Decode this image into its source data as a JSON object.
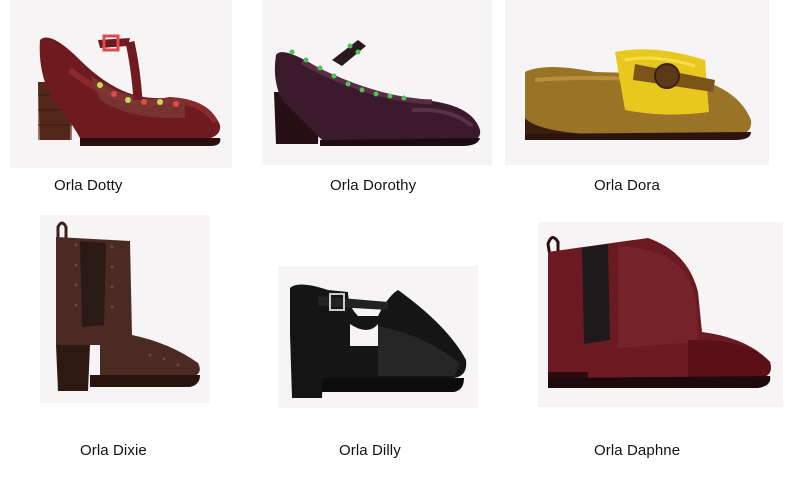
{
  "products": [
    {
      "name": "Orla Dotty",
      "image_icon": "t-bar-shoe-icon",
      "color": "#6e1a1f"
    },
    {
      "name": "Orla Dorothy",
      "image_icon": "mary-jane-shoe-icon",
      "color": "#3a1a2b"
    },
    {
      "name": "Orla Dora",
      "image_icon": "loafer-shoe-icon",
      "color": "#9a7426"
    },
    {
      "name": "Orla Dixie",
      "image_icon": "heeled-chelsea-boot-icon",
      "color": "#4a2a22"
    },
    {
      "name": "Orla Dilly",
      "image_icon": "cut-out-shoe-icon",
      "color": "#151515"
    },
    {
      "name": "Orla Daphne",
      "image_icon": "chelsea-boot-icon",
      "color": "#6b1a22"
    }
  ]
}
